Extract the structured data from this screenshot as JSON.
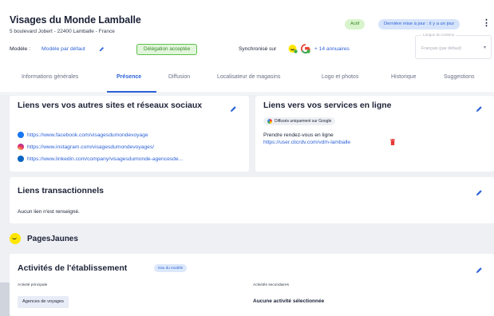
{
  "header": {
    "title": "Visages du Monde Lamballe",
    "address": "5 boulevard Jobert - 22400 Lamballe - France",
    "status_badge": "Actif",
    "update_badge": "Dernière mise à jour : il y a un jour",
    "menu_icon": "kebab-menu-icon"
  },
  "toolbar": {
    "model_label": "Modèle :",
    "model_value": "Modèle par défaut",
    "delegation_label": "Délégation acceptée",
    "sync_label": "Synchronisé sur",
    "sync_more": "+ 14 annuaires",
    "sync_icons": [
      "pagesjaunes-icon",
      "google-icon"
    ],
    "language_legend": "Langue du contenu",
    "language_value": "Français (par défaut)"
  },
  "tabs": [
    {
      "label": "Informations générales",
      "active": false
    },
    {
      "label": "Présence",
      "active": true
    },
    {
      "label": "Diffusion",
      "active": false
    },
    {
      "label": "Localisateur de magasins",
      "active": false
    },
    {
      "label": "Logo et photos",
      "active": false
    },
    {
      "label": "Historique",
      "active": false
    },
    {
      "label": "Suggestions",
      "active": false
    }
  ],
  "social_card": {
    "title": "Liens vers vos autres sites et réseaux sociaux",
    "links": [
      {
        "icon": "facebook-icon",
        "url": "https://www.facebook.com/visagesdumondevoyage"
      },
      {
        "icon": "instagram-icon",
        "url": "https://www.instagram.com/visagesdumondevoyages/"
      },
      {
        "icon": "linkedin-icon",
        "url": "https://www.linkedin.com/company/visagesdumonde-agencesde..."
      }
    ]
  },
  "services_card": {
    "title": "Liens vers vos services en ligne",
    "google_chip": "Diffusés uniquement sur Google",
    "booking_label": "Prendre rendez-vous en ligne",
    "booking_url": "https://user.clicrdv.com/vdm-lamballe"
  },
  "transactional_card": {
    "title": "Liens transactionnels",
    "empty_text": "Aucun lien n'est renseigné."
  },
  "pagesjaunes": {
    "title": "PagesJaunes"
  },
  "activities_card": {
    "title": "Activités de l'établissement",
    "model_chip": "Issu du modèle",
    "primary_label": "Activité principale",
    "primary_value": "Agences de voyages",
    "secondary_label": "Activités secondaires",
    "secondary_value": "Aucune activité sélectionnée"
  },
  "colors": {
    "accent": "#2e63d8",
    "success": "#3a8a2a",
    "background": "#eef0f4",
    "text": "#1c2237"
  }
}
